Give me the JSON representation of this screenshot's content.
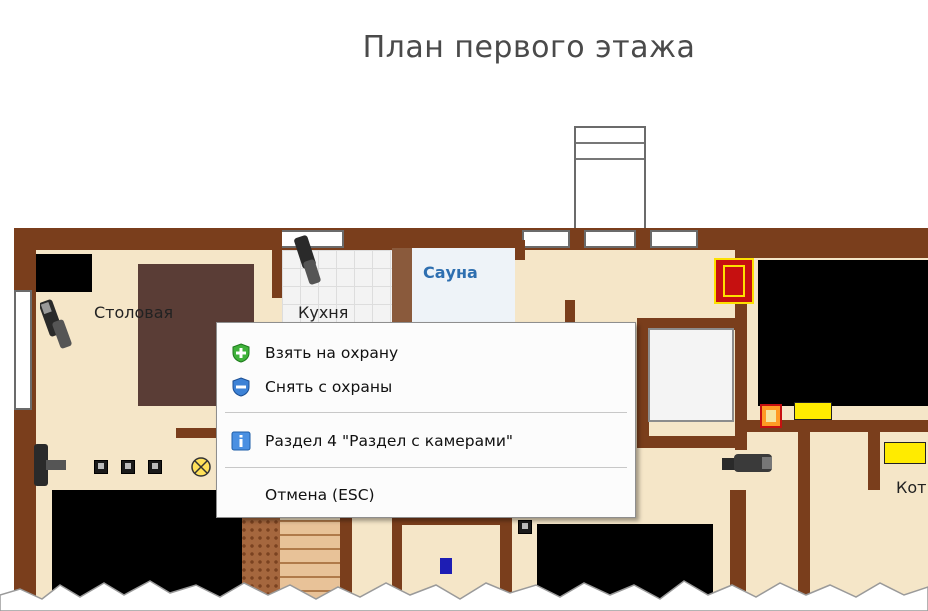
{
  "page": {
    "title": "План первого этажа"
  },
  "rooms": {
    "dining": "Столовая",
    "kitchen": "Кухня",
    "sauna": "Сауна",
    "boiler": "Кот"
  },
  "context_menu": {
    "items": [
      {
        "label": "Взять на охрану",
        "icon": "shield-plus-icon"
      },
      {
        "label": "Снять с охраны",
        "icon": "shield-minus-icon"
      },
      {
        "label": "Раздел 4  \"Раздел с камерами\"",
        "icon": "info-icon"
      },
      {
        "label": "Отмена (ESC)",
        "icon": ""
      }
    ]
  },
  "colors": {
    "wall": "#7a3e1c",
    "floor": "#f5e6c8",
    "sauna_text": "#2e6fb0",
    "menu_bg": "#fcfcfc"
  }
}
